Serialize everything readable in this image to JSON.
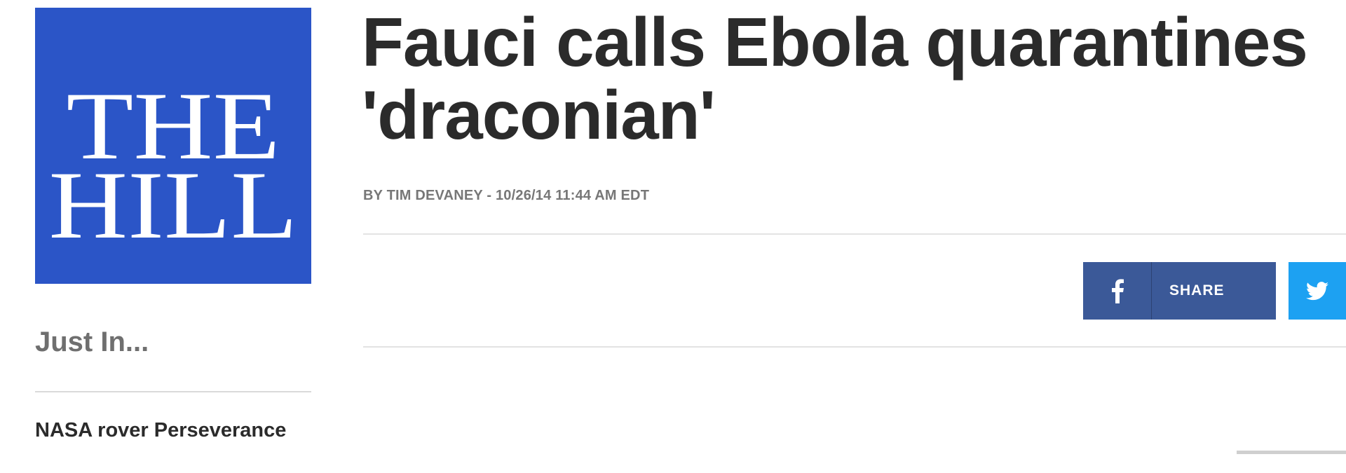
{
  "logo": {
    "line1": "THE",
    "line2": "HILL",
    "background": "#2b55c7"
  },
  "sidebar": {
    "heading": "Just In...",
    "headline": "NASA rover Perseverance"
  },
  "article": {
    "title_line1": "Fauci calls Ebola quarantines",
    "title_line2": "'draconian'",
    "byline": "BY TIM DEVANEY - 10/26/14 11:44 AM EDT"
  },
  "share": {
    "facebook_label": "SHARE",
    "facebook_color": "#3b5998",
    "twitter_color": "#1da1f2",
    "facebook_icon": "facebook-icon",
    "twitter_icon": "twitter-icon"
  }
}
